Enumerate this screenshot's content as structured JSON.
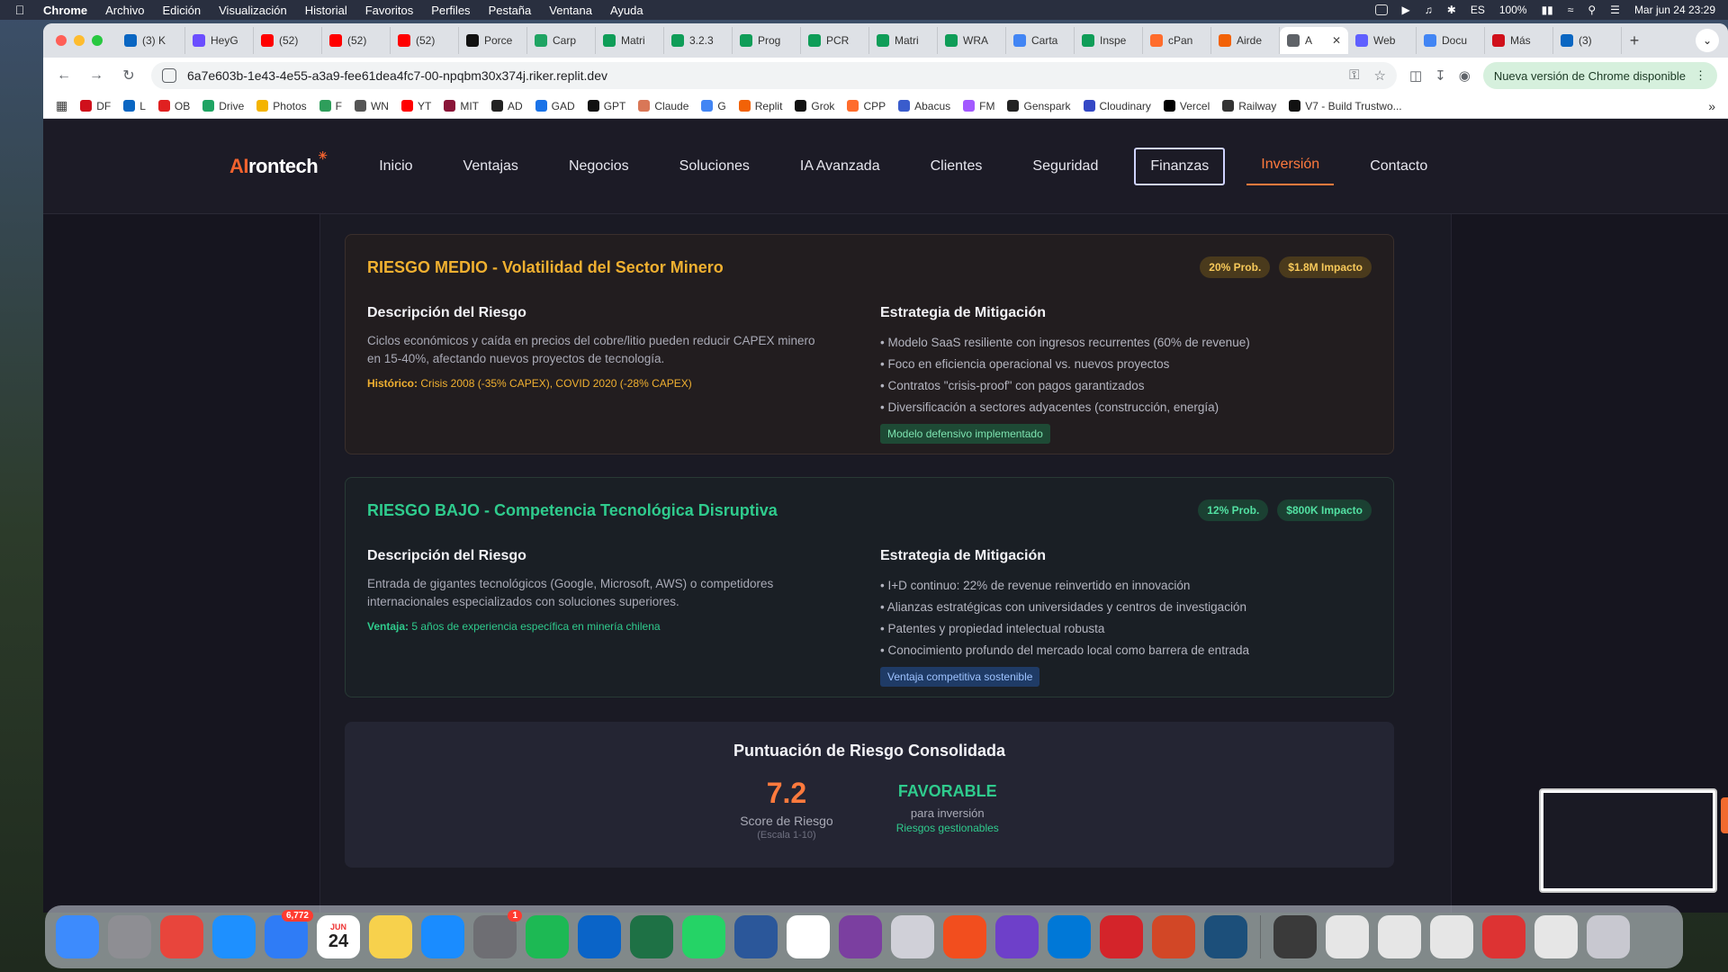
{
  "menubar": {
    "app": "Chrome",
    "items": [
      "Archivo",
      "Edición",
      "Visualización",
      "Historial",
      "Favoritos",
      "Perfiles",
      "Pestaña",
      "Ventana",
      "Ayuda"
    ],
    "battery": "100%",
    "datetime": "Mar jun 24  23:29"
  },
  "tabs": [
    {
      "label": "(3) K",
      "color": "#0a66c2",
      "icon": "linkedin-icon"
    },
    {
      "label": "HeyG",
      "color": "#6b4eff",
      "icon": "heygen-icon"
    },
    {
      "label": "(52)",
      "color": "#ff0000",
      "icon": "youtube-icon"
    },
    {
      "label": "(52)",
      "color": "#ff0000",
      "icon": "youtube-icon"
    },
    {
      "label": "(52)",
      "color": "#ff0000",
      "icon": "youtube-icon"
    },
    {
      "label": "Porce",
      "color": "#111111",
      "icon": "openai-icon"
    },
    {
      "label": "Carp",
      "color": "#1fa463",
      "icon": "drive-icon"
    },
    {
      "label": "Matri",
      "color": "#0f9d58",
      "icon": "sheets-icon"
    },
    {
      "label": "3.2.3",
      "color": "#0f9d58",
      "icon": "sheets-icon"
    },
    {
      "label": "Prog",
      "color": "#0f9d58",
      "icon": "sheets-icon"
    },
    {
      "label": "PCR",
      "color": "#0f9d58",
      "icon": "sheets-icon"
    },
    {
      "label": "Matri",
      "color": "#0f9d58",
      "icon": "sheets-icon"
    },
    {
      "label": "WRA",
      "color": "#0f9d58",
      "icon": "sheets-icon"
    },
    {
      "label": "Carta",
      "color": "#4285f4",
      "icon": "docs-icon"
    },
    {
      "label": "Inspe",
      "color": "#0f9d58",
      "icon": "sheets-icon"
    },
    {
      "label": "cPan",
      "color": "#ff6c2c",
      "icon": "cpanel-icon"
    },
    {
      "label": "Airde",
      "color": "#f26207",
      "icon": "replit-icon"
    },
    {
      "label": "A",
      "color": "#5f6368",
      "icon": "globe-icon",
      "active": true
    },
    {
      "label": "Web",
      "color": "#5f5fff",
      "icon": "web-icon"
    },
    {
      "label": "Docu",
      "color": "#4285f4",
      "icon": "document-icon"
    },
    {
      "label": "Más",
      "color": "#d0101b",
      "icon": "df-icon"
    },
    {
      "label": "(3)",
      "color": "#0a66c2",
      "icon": "linkedin-icon"
    }
  ],
  "url": "6a7e603b-1e43-4e55-a3a9-fee61dea4fc7-00-npqbm30x374j.riker.replit.dev",
  "update_label": "Nueva versión de Chrome disponible",
  "bookmarks": [
    {
      "label": "DF",
      "color": "#d0101b"
    },
    {
      "label": "L",
      "color": "#0a66c2"
    },
    {
      "label": "OB",
      "color": "#e02020"
    },
    {
      "label": "Drive",
      "color": "#1fa463"
    },
    {
      "label": "Photos",
      "color": "#f4b400"
    },
    {
      "label": "F",
      "color": "#2e9e5b"
    },
    {
      "label": "WN",
      "color": "#555555"
    },
    {
      "label": "YT",
      "color": "#ff0000"
    },
    {
      "label": "MIT",
      "color": "#8a1538"
    },
    {
      "label": "AD",
      "color": "#222222"
    },
    {
      "label": "GAD",
      "color": "#1a73e8"
    },
    {
      "label": "GPT",
      "color": "#111111"
    },
    {
      "label": "Claude",
      "color": "#d97757"
    },
    {
      "label": "G",
      "color": "#4285f4"
    },
    {
      "label": "Replit",
      "color": "#f26207"
    },
    {
      "label": "Grok",
      "color": "#111111"
    },
    {
      "label": "CPP",
      "color": "#ff6c2c"
    },
    {
      "label": "Abacus",
      "color": "#3a5ccc"
    },
    {
      "label": "FM",
      "color": "#a259ff"
    },
    {
      "label": "Genspark",
      "color": "#222222"
    },
    {
      "label": "Cloudinary",
      "color": "#3448c5"
    },
    {
      "label": "Vercel",
      "color": "#000000"
    },
    {
      "label": "Railway",
      "color": "#333333"
    },
    {
      "label": "V7 - Build Trustwo...",
      "color": "#111111"
    }
  ],
  "site": {
    "logo_ai": "AI",
    "logo_rest": "rontech",
    "nav": [
      "Inicio",
      "Ventajas",
      "Negocios",
      "Soluciones",
      "IA Avanzada",
      "Clientes",
      "Seguridad",
      "Finanzas",
      "Inversión",
      "Contacto"
    ]
  },
  "risks": {
    "medio": {
      "title": "RIESGO MEDIO - Volatilidad del Sector Minero",
      "prob": "20% Prob.",
      "impact": "$1.8M Impacto",
      "desc_title": "Descripción del Riesgo",
      "desc": "Ciclos económicos y caída en precios del cobre/litio pueden reducir CAPEX minero en 15-40%, afectando nuevos proyectos de tecnología.",
      "note_label": "Histórico:",
      "note_text": " Crisis 2008 (-35% CAPEX), COVID 2020 (-28% CAPEX)",
      "mit_title": "Estrategia de Mitigación",
      "bullets": [
        "Modelo SaaS resiliente con ingresos recurrentes (60% de revenue)",
        "Foco en eficiencia operacional vs. nuevos proyectos",
        "Contratos \"crisis-proof\" con pagos garantizados",
        "Diversificación a sectores adyacentes (construcción, energía)"
      ],
      "tag": "Modelo defensivo implementado"
    },
    "bajo": {
      "title": "RIESGO BAJO - Competencia Tecnológica Disruptiva",
      "prob": "12% Prob.",
      "impact": "$800K Impacto",
      "desc_title": "Descripción del Riesgo",
      "desc": "Entrada de gigantes tecnológicos (Google, Microsoft, AWS) o competidores internacionales especializados con soluciones superiores.",
      "note_label": "Ventaja:",
      "note_text": " 5 años de experiencia específica en minería chilena",
      "mit_title": "Estrategia de Mitigación",
      "bullets": [
        "I+D continuo: 22% de revenue reinvertido en innovación",
        "Alianzas estratégicas con universidades y centros de investigación",
        "Patentes y propiedad intelectual robusta",
        "Conocimiento profundo del mercado local como barrera de entrada"
      ],
      "tag": "Ventaja competitiva sostenible"
    }
  },
  "score": {
    "title": "Puntuación de Riesgo Consolidada",
    "value": "7.2",
    "label": "Score de Riesgo",
    "scale": "(Escala 1-10)",
    "verdict": "FAVORABLE",
    "verdict_sub": "para inversión",
    "verdict_note": "Riesgos gestionables"
  },
  "dock": {
    "mail_badge": "6,772",
    "settings_badge": "1",
    "calendar_month": "JUN",
    "calendar_day": "24",
    "apps": [
      {
        "name": "finder-icon",
        "color": "#3d8bfd"
      },
      {
        "name": "launchpad-icon",
        "color": "#8e8e93"
      },
      {
        "name": "chrome-icon",
        "color": "#e8453c"
      },
      {
        "name": "safari-icon",
        "color": "#1e90ff"
      },
      {
        "name": "mail-icon",
        "color": "#2f7cf6"
      },
      {
        "name": "calendar-icon",
        "color": "#ffffff"
      },
      {
        "name": "notes-icon",
        "color": "#f7d14c"
      },
      {
        "name": "keynote-icon",
        "color": "#1a8cff"
      },
      {
        "name": "system-settings-icon",
        "color": "#6e6e73"
      },
      {
        "name": "spotify-icon",
        "color": "#1db954"
      },
      {
        "name": "outlook-icon",
        "color": "#0a64c8"
      },
      {
        "name": "excel-icon",
        "color": "#1e7145"
      },
      {
        "name": "whatsapp-icon",
        "color": "#25d366"
      },
      {
        "name": "word-icon",
        "color": "#2b579a"
      },
      {
        "name": "calendar31-icon",
        "color": "#ffffff"
      },
      {
        "name": "obs-icon",
        "color": "#7b3fa0"
      },
      {
        "name": "pen-app-icon",
        "color": "#d0d0d8"
      },
      {
        "name": "figma-like-icon",
        "color": "#f24e1e"
      },
      {
        "name": "github-icon",
        "color": "#6e40c9"
      },
      {
        "name": "vscode-icon",
        "color": "#0078d7"
      },
      {
        "name": "acrobat-icon",
        "color": "#d4242a"
      },
      {
        "name": "powerpoint-icon",
        "color": "#d24726"
      },
      {
        "name": "quicktime-icon",
        "color": "#1c4f7a"
      }
    ],
    "recent": [
      {
        "name": "recent-window-1",
        "color": "#3a3a3a"
      },
      {
        "name": "recent-window-2",
        "color": "#e6e6e6"
      },
      {
        "name": "recent-window-3",
        "color": "#e6e6e6"
      },
      {
        "name": "recent-window-4",
        "color": "#e6e6e6"
      },
      {
        "name": "recent-window-5",
        "color": "#d33"
      },
      {
        "name": "recent-window-6",
        "color": "#e6e6e6"
      },
      {
        "name": "trash-icon",
        "color": "#c8c8d0"
      }
    ]
  }
}
